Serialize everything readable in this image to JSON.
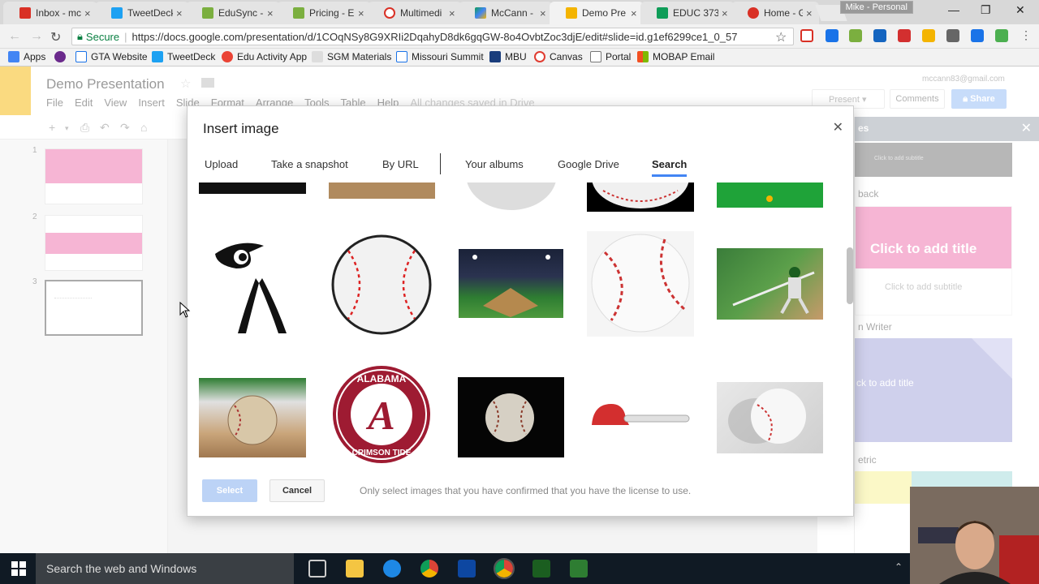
{
  "browser": {
    "tabs": [
      {
        "label": "Inbox - mc",
        "color": "#d93025"
      },
      {
        "label": "TweetDeck",
        "color": "#1da1f2"
      },
      {
        "label": "EduSync -",
        "color": "#7baf3f"
      },
      {
        "label": "Pricing - E",
        "color": "#7baf3f"
      },
      {
        "label": "Multimedi",
        "color": "#d93025"
      },
      {
        "label": "McCann -",
        "color": "#4285f4"
      },
      {
        "label": "Demo Pre",
        "color": "#f4b400"
      },
      {
        "label": "EDUC 373",
        "color": "#0f9d58"
      },
      {
        "label": "Home - G",
        "color": "#d93025"
      }
    ],
    "profile": "Mike - Personal",
    "secure_label": "Secure",
    "url": "https://docs.google.com/presentation/d/1COqNSy8G9XRIi2DqahyD8dk6gqGW-8o4OvbtZoc3djE/edit#slide=id.g1ef6299ce1_0_57",
    "bookmarks": [
      {
        "label": "Apps",
        "color": "#4285f4"
      },
      {
        "label": "",
        "color": "#6b2a8c"
      },
      {
        "label": "GTA Website",
        "color": "#1a73e8"
      },
      {
        "label": "TweetDeck",
        "color": "#1da1f2"
      },
      {
        "label": "Edu Activity App",
        "color": "#ea4335"
      },
      {
        "label": "SGM Materials",
        "color": "#999999"
      },
      {
        "label": "Missouri Summit",
        "color": "#1a73e8"
      },
      {
        "label": "MBU",
        "color": "#1a3d7c"
      },
      {
        "label": "Canvas",
        "color": "#e03c31"
      },
      {
        "label": "Portal",
        "color": "#777777"
      },
      {
        "label": "MOBAP Email",
        "color": "#f25022"
      }
    ]
  },
  "docs": {
    "title": "Demo Presentation",
    "menus": [
      "File",
      "Edit",
      "View",
      "Insert",
      "Slide",
      "Format",
      "Arrange",
      "Tools",
      "Table",
      "Help"
    ],
    "saved_status": "All changes saved in Drive",
    "account": "mccann83@gmail.com",
    "present_label": "Present",
    "comments_label": "Comments",
    "share_label": "Share",
    "slide_numbers": [
      "1",
      "2",
      "3"
    ],
    "themes_header": "es",
    "theme_labels": [
      "back",
      "n Writer",
      "etric"
    ],
    "theme_title": "Click to add title",
    "theme_subtitle": "Click to add subtitle",
    "theme_title2": "ck to add title"
  },
  "dialog": {
    "title": "Insert image",
    "tabs": [
      "Upload",
      "Take a snapshot",
      "By URL",
      "Your albums",
      "Google Drive",
      "Search"
    ],
    "active_tab": "Search",
    "select_label": "Select",
    "cancel_label": "Cancel",
    "notice": "Only select images that you have confirmed that you have the license to use.",
    "alabama_top": "ALABAMA",
    "alabama_bottom": "CRIMSON TIDE",
    "alabama_letter": "A"
  },
  "taskbar": {
    "search_placeholder": "Search the web and Windows"
  },
  "colors": {
    "accent": "#4285f4",
    "slide_pink": "#ec6aa8",
    "crimson": "#9e1b32",
    "theme_lavender": "#9fa0d9"
  }
}
